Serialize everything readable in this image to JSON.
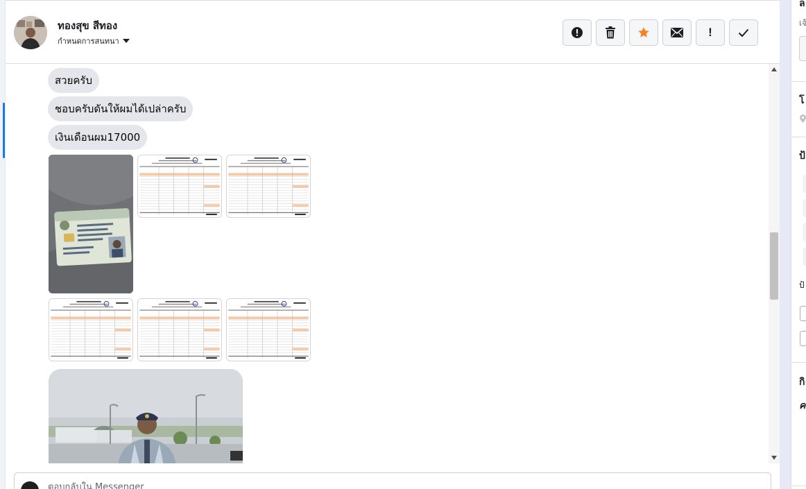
{
  "contact": {
    "name": "ทองสุข สีทอง",
    "label_action": "กำหนดการสนทนา"
  },
  "toolbar": {
    "buttons": [
      {
        "id": "spam",
        "icon": "alert-circle-icon"
      },
      {
        "id": "delete",
        "icon": "trash-icon"
      },
      {
        "id": "star",
        "icon": "star-icon",
        "color": "#f5821f"
      },
      {
        "id": "unread",
        "icon": "envelope-icon"
      },
      {
        "id": "important",
        "icon": "exclamation-icon",
        "glyph": "!"
      },
      {
        "id": "done",
        "icon": "checkmark-icon"
      }
    ]
  },
  "messages": {
    "bubbles": [
      "สวยครับ",
      "ชอบครับดันให้ผมได้เปล่าครับ",
      "เงินเดือนผม17000"
    ],
    "attachments": [
      "id-card-photo",
      "pay-slip",
      "pay-slip",
      "pay-slip",
      "pay-slip",
      "pay-slip",
      "person-photo"
    ]
  },
  "composer": {
    "placeholder": "ตอบกลับใน Messenger"
  },
  "right_panel": {
    "section_glyphs": [
      "ล",
      "เจ้",
      "โ",
      "ป้",
      "ป้",
      "กิ",
      "ค"
    ]
  },
  "colors": {
    "accent": "#1877f2",
    "star": "#f5821f",
    "bubble": "#e4e6eb",
    "border": "#ccd0d5"
  }
}
